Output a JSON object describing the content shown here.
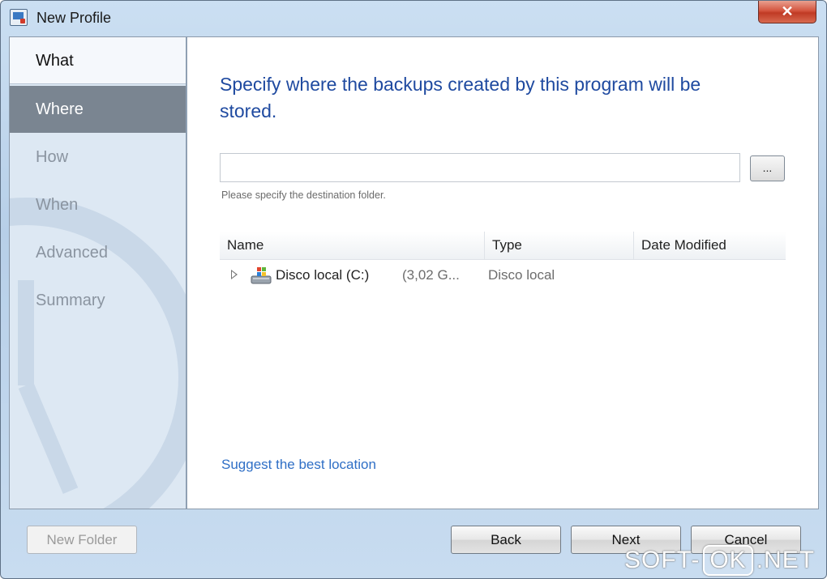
{
  "window": {
    "title": "New Profile",
    "close_label": "✕"
  },
  "sidebar": {
    "items": [
      {
        "label": "What",
        "state": "done"
      },
      {
        "label": "Where",
        "state": "active"
      },
      {
        "label": "How",
        "state": "todo"
      },
      {
        "label": "When",
        "state": "todo"
      },
      {
        "label": "Advanced",
        "state": "todo"
      },
      {
        "label": "Summary",
        "state": "todo"
      }
    ]
  },
  "main": {
    "heading": "Specify where the backups created by this program will be stored.",
    "path_value": "",
    "browse_label": "...",
    "hint": "Please specify the destination folder.",
    "columns": [
      "Name",
      "Type",
      "Date Modified"
    ],
    "rows": [
      {
        "name": "Disco local (C:)",
        "size": "(3,02 G...",
        "type": "Disco local",
        "date": ""
      }
    ],
    "suggest_link": "Suggest the best location"
  },
  "footer": {
    "new_folder": "New Folder",
    "back": "Back",
    "next": "Next",
    "cancel": "Cancel"
  },
  "watermark": {
    "left": "SOFT-",
    "ok": "OK",
    "right": ".NET"
  },
  "colors": {
    "heading": "#1f4aa0",
    "active_nav": "#7a8591",
    "link": "#2f6fc6"
  }
}
